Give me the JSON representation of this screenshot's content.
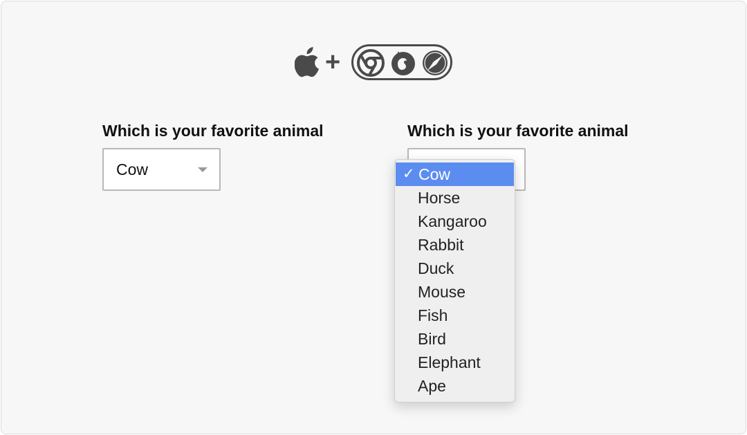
{
  "header": {
    "plus_sign": "+",
    "icons": [
      "apple-icon",
      "chrome-icon",
      "firefox-icon",
      "safari-icon"
    ]
  },
  "left_select": {
    "label": "Which is your favorite animal",
    "value": "Cow"
  },
  "right_select": {
    "label": "Which is your favorite animal",
    "value": "Cow",
    "open": true,
    "checkmark": "✓",
    "options": [
      "Cow",
      "Horse",
      "Kangaroo",
      "Rabbit",
      "Duck",
      "Mouse",
      "Fish",
      "Bird",
      "Elephant",
      "Ape"
    ],
    "selected_index": 0
  },
  "colors": {
    "highlight": "#5b8cf0",
    "icon_gray": "#4a4a4a",
    "background": "#f7f7f7"
  }
}
